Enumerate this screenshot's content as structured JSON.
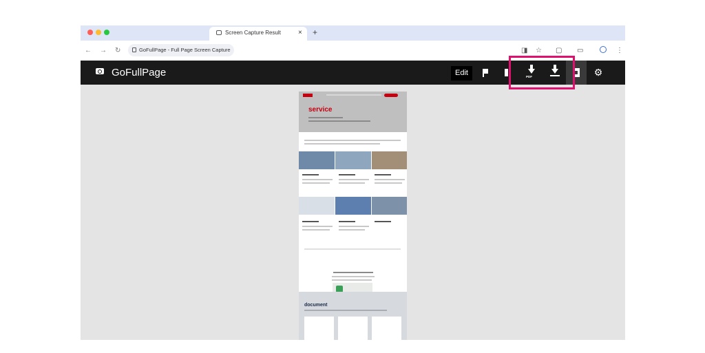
{
  "browser": {
    "tab_title": "Screen Capture Result",
    "tab_close": "×",
    "new_tab": "+",
    "address_text": "GoFullPage - Full Page Screen Capture",
    "nav_back": "←",
    "nav_forward": "→",
    "nav_reload": "↻",
    "traffic_colors": [
      "#ff5f57",
      "#febc2e",
      "#28c840"
    ]
  },
  "toolbar": {
    "brand": "GoFullPage",
    "edit_label": "Edit",
    "pdf_label": "PDF",
    "gear_glyph": "⚙",
    "highlight_color": "#e0106e"
  },
  "preview": {
    "hero_title": "service",
    "accent": "#c40010",
    "document_title": "document"
  }
}
